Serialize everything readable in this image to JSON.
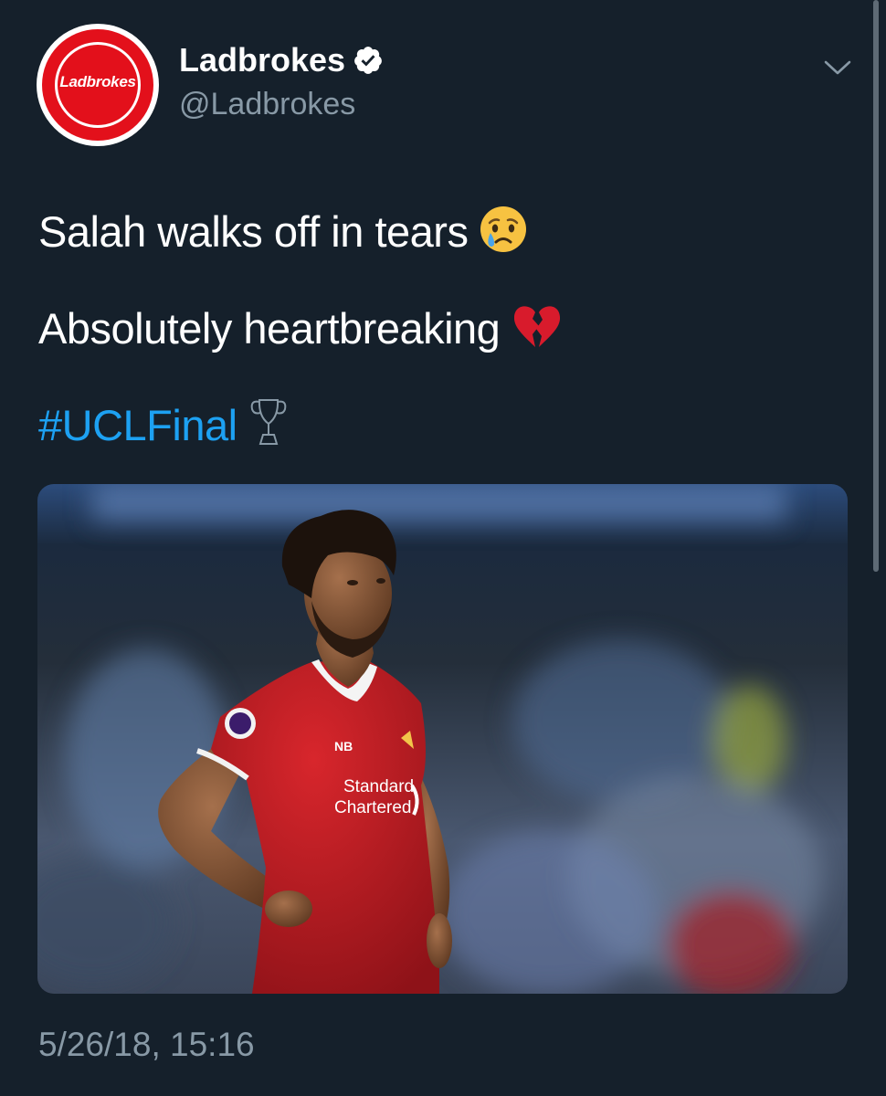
{
  "account": {
    "avatar_logo_text": "Ladbrokes",
    "display_name": "Ladbrokes",
    "handle": "@Ladbrokes",
    "verified": true
  },
  "tweet": {
    "line1": "Salah walks off in tears",
    "line1_emoji": "crying-face",
    "line2": "Absolutely heartbreaking",
    "line2_emoji": "broken-heart",
    "hashtag": "#UCLFinal",
    "hashtag_emoji": "trophy-outline",
    "photo_kit_sponsor": "Standard\nChartered",
    "timestamp": "5/26/18, 15:16"
  },
  "colors": {
    "background": "#15202b",
    "hashtag": "#1da1f2",
    "secondary_text": "#8899a6",
    "brand_red": "#e3101b",
    "verified": "#ffffff"
  }
}
